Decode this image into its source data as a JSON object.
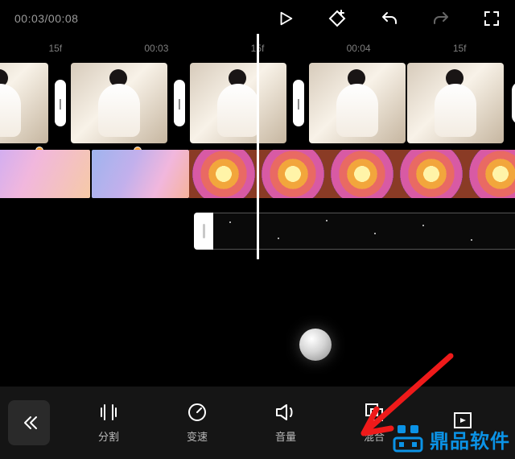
{
  "header": {
    "timecode": "00:03/00:08"
  },
  "ruler": [
    "15f",
    "00:03",
    "15f",
    "00:04",
    "15f"
  ],
  "tracks": {
    "addLabel": "+",
    "transitionGlyph": "|"
  },
  "toolbar": {
    "split": "分割",
    "speed": "变速",
    "volume": "音量",
    "blend": "混合",
    "canvas": ""
  },
  "watermark": {
    "text": "鼎品软件"
  },
  "icons": {
    "play": "play-icon",
    "keyframe": "keyframe-add-icon",
    "undo": "undo-icon",
    "redo": "redo-icon",
    "fullscreen": "fullscreen-icon",
    "back": "back-icon",
    "split": "split-icon",
    "speed": "speed-icon",
    "volume": "volume-icon",
    "blend": "blend-icon",
    "canvas": "canvas-icon"
  }
}
